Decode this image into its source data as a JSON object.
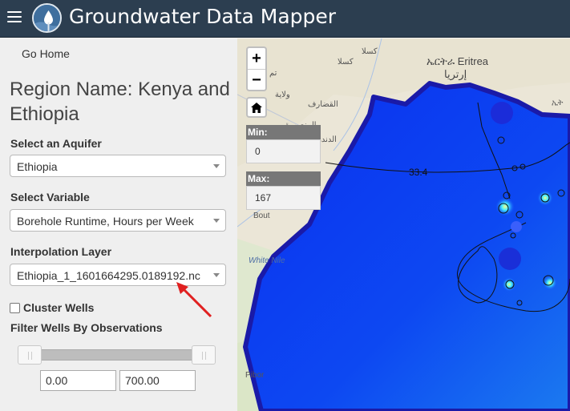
{
  "header": {
    "title": "Groundwater Data Mapper"
  },
  "sidebar": {
    "go_home": "Go Home",
    "region_title": "Region Name: Kenya and Ethiopia",
    "aquifer": {
      "label": "Select an Aquifer",
      "value": "Ethiopia"
    },
    "variable": {
      "label": "Select Variable",
      "value": "Borehole Runtime, Hours per Week"
    },
    "interpolation": {
      "label": "Interpolation Layer",
      "value": "Ethiopia_1_1601664295.0189192.nc"
    },
    "cluster_label": "Cluster Wells",
    "filter_label": "Filter Wells By Observations",
    "filter_min": "0.00",
    "filter_max": "700.00",
    "filter_range": [
      0,
      700
    ]
  },
  "map": {
    "zoom_in": "+",
    "zoom_out": "−",
    "min_label": "Min:",
    "min_value": "0",
    "max_label": "Max:",
    "max_value": "167",
    "contour_value": "33.4",
    "place_labels": {
      "kassala_en": "كسلا",
      "kassala": "كسلا",
      "eritrea_native": "ኤርትራ Eritrea",
      "eritrea_ar": "إرتريا",
      "gedaref": "القضارف",
      "sinnar": "الدندر",
      "mansura": "المنصورة",
      "tam": "تم",
      "wilaya": "ولاية",
      "bout": "Bout",
      "white_nile": "White Nile",
      "pibor": "Pibor",
      "ethiopia_edge": "ኢት"
    },
    "colors": {
      "overlay_border": "#1a1aa8",
      "overlay_fill": "#0f3ff0",
      "arrow": "#e02020"
    }
  }
}
